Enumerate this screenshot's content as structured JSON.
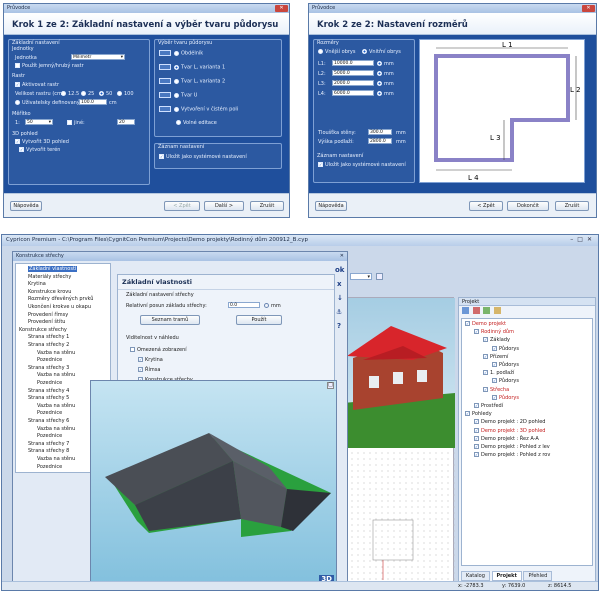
{
  "dialog1": {
    "window_title": "Průvodce",
    "header": "Krok 1 ze 2:  Základní nastavení a výběr tvaru půdorysu",
    "groups": {
      "basic": "Základní nastavení",
      "units_group": "Jednotky",
      "units_label": "Jednotka",
      "units_value": "Milimetr",
      "use_grid": "Použít jemný/hrubý rastr",
      "grid": "Rastr",
      "grid_active": "Aktivovat rastr",
      "grid_size_label": "Velikost rastru (cm):",
      "grid_options": [
        "12.5",
        "25",
        "50",
        "100"
      ],
      "user_defined": "Uživatelsky definovaný",
      "user_value": "100.0",
      "user_unit": "cm",
      "scale": "Měřítko",
      "scale_prefix": "1:",
      "scale_value": "50",
      "scale_other": "jiné:",
      "scale_other_value": "20",
      "view3d": "3D pohled",
      "view3d_show": "Vytvořit 3D pohled",
      "view3d_draw": "Vytvořit terén",
      "shape_group": "Výběr tvaru půdorysu",
      "shapes": [
        "Obdélník",
        "Tvar L, varianta 1",
        "Tvar L, varianta 2",
        "Tvar U",
        "Vytvoření v čistém poli",
        "Volné editace"
      ],
      "save_group": "Záznam nastavení",
      "save_default": "Uložit jako systémové nastavení"
    },
    "buttons": {
      "help": "Nápověda",
      "back": "< Zpět",
      "next": "Další >",
      "cancel": "Zrušit"
    }
  },
  "dialog2": {
    "window_title": "Průvodce",
    "header": "Krok 2 ze 2: Nastavení rozměrů",
    "dims_group": "Rozměry",
    "dims_mode": [
      "Vnější obrys",
      "Vnitřní obrys"
    ],
    "rows": [
      {
        "label": "L1:",
        "value": "10000.0",
        "unit": "mm"
      },
      {
        "label": "L2:",
        "value": "5000.0",
        "unit": "mm"
      },
      {
        "label": "L3:",
        "value": "2000.0",
        "unit": "mm"
      },
      {
        "label": "L4:",
        "value": "6000.0",
        "unit": "mm"
      }
    ],
    "wall_label": "Tloušťka stěny:",
    "wall_value": "300.0",
    "height_label": "Výška podlaží:",
    "height_value": "2800.0",
    "unit": "mm",
    "save_group": "Záznam nastavení",
    "save_default": "Uložit jako systémové nastavení",
    "diagram_labels": [
      "L 1",
      "L 2",
      "L 3",
      "L 4"
    ],
    "buttons": {
      "help": "Nápověda",
      "back": "< Zpět",
      "finish": "Dokončit",
      "cancel": "Zrušit"
    }
  },
  "main": {
    "window_title": "Cypricon Premium - C:\\Program Files\\CygnitCon Premium\\Projects\\Demo projekty\\Rodinný dům 200912_B.cyp",
    "construction_title": "Konstrukce střechy",
    "tree": [
      {
        "label": "Základní vlastnosti",
        "depth": 1,
        "selected": true
      },
      {
        "label": "Materiály střechy",
        "depth": 1
      },
      {
        "label": "Krytina",
        "depth": 1
      },
      {
        "label": "Konstrukce krovu",
        "depth": 1
      },
      {
        "label": "Rozměry dřevěných prvků",
        "depth": 1
      },
      {
        "label": "Ukončení krokve u okapu",
        "depth": 1
      },
      {
        "label": "Provedení římsy",
        "depth": 1
      },
      {
        "label": "Provedení štítu",
        "depth": 1
      },
      {
        "label": "Konstrukce střechy",
        "depth": 0
      },
      {
        "label": "Strana střechy 1",
        "depth": 1
      },
      {
        "label": "Strana střechy 2",
        "depth": 1
      },
      {
        "label": "Vazba na stěnu",
        "depth": 2
      },
      {
        "label": "Pozednice",
        "depth": 2
      },
      {
        "label": "Strana střechy 3",
        "depth": 1
      },
      {
        "label": "Vazba na stěnu",
        "depth": 2
      },
      {
        "label": "Pozednice",
        "depth": 2
      },
      {
        "label": "Strana střechy 4",
        "depth": 1
      },
      {
        "label": "Strana střechy 5",
        "depth": 1
      },
      {
        "label": "Vazba na stěnu",
        "depth": 2
      },
      {
        "label": "Pozednice",
        "depth": 2
      },
      {
        "label": "Strana střechy 6",
        "depth": 1
      },
      {
        "label": "Vazba na stěnu",
        "depth": 2
      },
      {
        "label": "Pozednice",
        "depth": 2
      },
      {
        "label": "Strana střechy 7",
        "depth": 1
      },
      {
        "label": "Strana střechy 8",
        "depth": 1
      },
      {
        "label": "Vazba na stěnu",
        "depth": 2
      },
      {
        "label": "Pozednice",
        "depth": 2
      }
    ],
    "props": {
      "title": "Základní vlastnosti",
      "section": "Základní nastavení střechy",
      "offset_label": "Relativní posun základu střechy:",
      "offset_value": "0.0",
      "offset_unit": "mm",
      "list_button": "Seznam tramů",
      "apply_button": "Použít",
      "visibility_label": "Viditelnost v náhledu",
      "items": [
        "Omezená zobrazení",
        "Krytina",
        "Římsa",
        "Konstrukce střechy"
      ]
    },
    "side_buttons": [
      "ok",
      "x",
      "↓",
      "⚓",
      "?"
    ],
    "project": {
      "title": "Projekt",
      "items": [
        {
          "label": "Demo projekt",
          "depth": 0,
          "red": true
        },
        {
          "label": "Rodinný dům",
          "depth": 1,
          "red": true
        },
        {
          "label": "Základy",
          "depth": 2
        },
        {
          "label": "Půdorys",
          "depth": 3
        },
        {
          "label": "Přízemí",
          "depth": 2
        },
        {
          "label": "Půdorys",
          "depth": 3
        },
        {
          "label": "1. podlaží",
          "depth": 2
        },
        {
          "label": "Půdorys",
          "depth": 3
        },
        {
          "label": "Střecha",
          "depth": 2,
          "red": true
        },
        {
          "label": "Půdorys",
          "depth": 3,
          "red": true
        },
        {
          "label": "Prostředí",
          "depth": 1
        },
        {
          "label": "Pohledy",
          "depth": 0
        },
        {
          "label": "Demo projekt : 2D pohled",
          "depth": 1
        },
        {
          "label": "Demo projekt : 3D pohled",
          "depth": 1,
          "red": true
        },
        {
          "label": "Demo projekt : Řez A-A",
          "depth": 1
        },
        {
          "label": "Demo projekt : Pohled z lev",
          "depth": 1
        },
        {
          "label": "Demo projekt : Pohled z rov",
          "depth": 1
        }
      ],
      "tabs": [
        "Katalog",
        "Projekt",
        "Přehled"
      ]
    },
    "view_badge": "3D",
    "statusbar": {
      "x": "x: -2783.3",
      "y": "y: 7639.0",
      "z": "z: 8614.5"
    }
  }
}
